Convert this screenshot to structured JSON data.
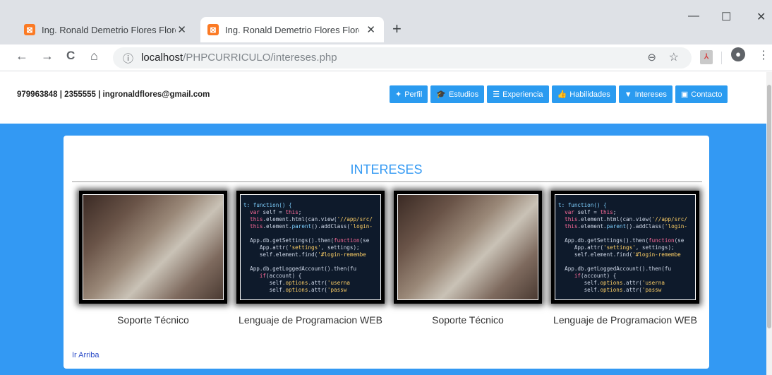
{
  "browser": {
    "tabs": [
      {
        "title": "Ing. Ronald Demetrio Flores Flore",
        "favicon": "xampp-icon",
        "close": "✕"
      },
      {
        "title": "Ing. Ronald Demetrio Flores Flore",
        "favicon": "xampp-icon",
        "close": "✕"
      }
    ],
    "new_tab": "+",
    "window_controls": {
      "minimize": "—",
      "maximize": "☐",
      "close": "✕"
    },
    "nav": {
      "back": "←",
      "forward": "→",
      "reload": "C",
      "home": "⌂"
    },
    "url_host": "localhost",
    "url_path": "/PHPCURRICULO/intereses.php",
    "info_icon": "ⓘ",
    "zoom_icon": "⊖",
    "star_icon": "☆",
    "menu_icon": "⋮"
  },
  "header": {
    "contact": "979963848 | 2355555 | ingronaldflores@gmail.com",
    "nav_buttons": [
      {
        "label": "Perfil",
        "icon": "person-icon",
        "glyph": "✦"
      },
      {
        "label": "Estudios",
        "icon": "graduation-cap-icon",
        "glyph": "🎓"
      },
      {
        "label": "Experiencia",
        "icon": "database-icon",
        "glyph": "☰"
      },
      {
        "label": "Habilidades",
        "icon": "thumbs-up-icon",
        "glyph": "👍"
      },
      {
        "label": "Intereses",
        "icon": "filter-icon",
        "glyph": "▼"
      },
      {
        "label": "Contacto",
        "icon": "contact-card-icon",
        "glyph": "▣"
      }
    ]
  },
  "section": {
    "title": "INTERESES",
    "items": [
      {
        "caption": "Soporte Técnico",
        "image": "tech-support-photo"
      },
      {
        "caption": "Lenguaje de Programacion WEB",
        "image": "code-screenshot"
      },
      {
        "caption": "Soporte Técnico",
        "image": "tech-support-photo"
      },
      {
        "caption": "Lenguaje de Programacion WEB",
        "image": "code-screenshot"
      }
    ],
    "back_to_top": "Ir Arriba"
  },
  "colors": {
    "primary": "#3399f3",
    "button": "#2a9bf0",
    "link": "#2a4bc8"
  }
}
